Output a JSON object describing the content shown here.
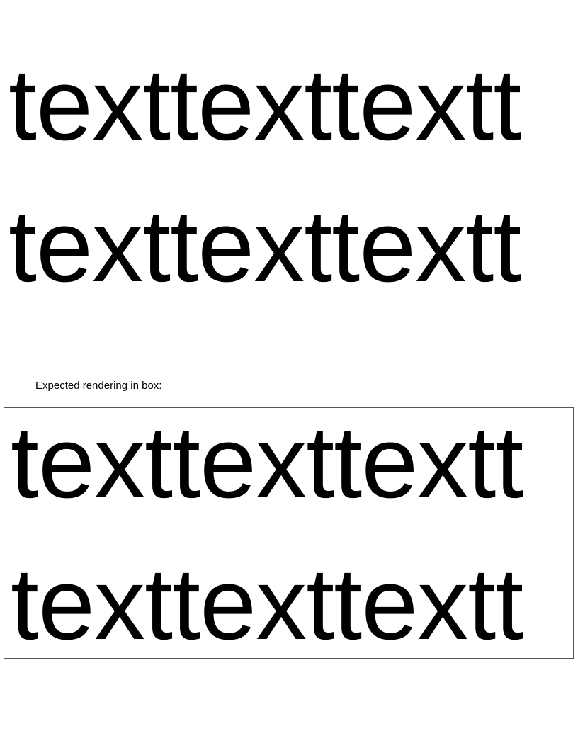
{
  "test": {
    "lines": [
      "texttexttextt",
      "texttexttextt"
    ]
  },
  "caption": "Expected rendering in box:",
  "reference": {
    "lines": [
      "texttexttextt",
      "texttexttextt"
    ]
  }
}
